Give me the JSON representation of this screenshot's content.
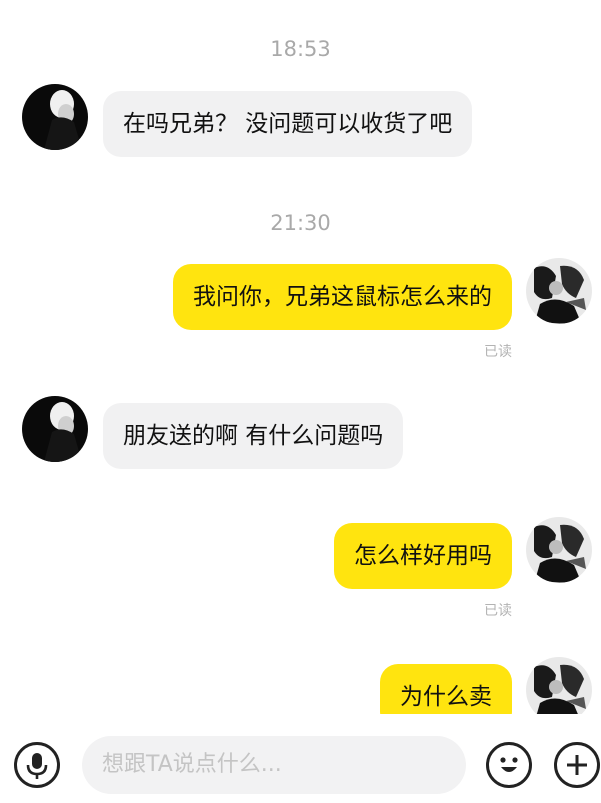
{
  "chat": {
    "messages": [
      {
        "time": "18:53",
        "direction": "in",
        "text": "在吗兄弟？ 没问题可以收货了吧"
      },
      {
        "time": "21:30",
        "direction": "out",
        "text": "我问你，兄弟这鼠标怎么来的",
        "status": "已读"
      },
      {
        "direction": "in",
        "text": "朋友送的啊 有什么问题吗"
      },
      {
        "direction": "out",
        "text": "怎么样好用吗",
        "status": "已读"
      },
      {
        "direction": "out",
        "text": "为什么卖"
      }
    ]
  },
  "composer": {
    "placeholder": "想跟TA说点什么...",
    "voice_icon": "microphone-icon",
    "emoji_icon": "emoji-icon",
    "add_icon": "plus-icon"
  },
  "colors": {
    "outgoing_bubble": "#ffe40f",
    "incoming_bubble": "#f1f1f2",
    "timestamp": "#a9a9a9"
  }
}
